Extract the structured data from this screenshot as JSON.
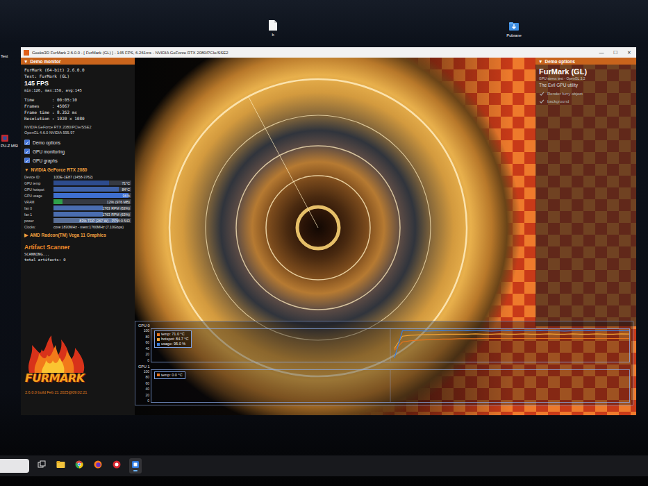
{
  "desktop": {
    "icons": [
      {
        "label": "b",
        "kind": "document"
      },
      {
        "label": "Pobrane",
        "kind": "downloads"
      }
    ],
    "edge_labels": [
      {
        "label": "Test",
        "kind": "plain"
      },
      {
        "label": "PU-Z MSI",
        "kind": "cpuz"
      }
    ]
  },
  "window": {
    "title": "Geeks3D FurMark 2.6.0.0 - [ FurMark (GL) ] - 145 FPS, 6.261ms - NVIDIA GeForce RTX 2080/PCIe/SSE2",
    "controls": [
      "—",
      "☐",
      "✕"
    ]
  },
  "monitor": {
    "toggle": "▼",
    "header": "Demo monitor",
    "app": "FurMark (64-bit) 2.6.0.0",
    "test": "Test: FurMark (GL)",
    "fps": "145 FPS",
    "fps_stats": "min:126, max:150, avg:145",
    "stats": [
      "Time       : 00:05:10",
      "Frames     : 45067",
      "Frame time : 8.352 ms",
      "Resolution : 1920 x 1080"
    ],
    "renderer": "NVIDIA GeForce RTX 2080/PCIe/SSE2",
    "opengl": "OpenGL 4.6.0 NVIDIA 595.97",
    "options": [
      {
        "label": "Demo options",
        "checked": true
      },
      {
        "label": "GPU monitoring",
        "checked": true
      },
      {
        "label": "GPU graphs",
        "checked": true
      }
    ]
  },
  "gpu": {
    "toggle": "▼",
    "name": "NVIDIA GeForce RTX 2080",
    "expanded": true,
    "device_label": "Device ID:",
    "device_id": "10DE-1E87 (1458-3762)",
    "rows": [
      {
        "label": "GPU temp",
        "value": "71°C",
        "level": 0.71,
        "color": "#2d4c8e"
      },
      {
        "label": "GPU hotspot",
        "value": "84°C",
        "level": 0.84,
        "color": "#3f62a8"
      },
      {
        "label": "GPU usage",
        "value": "96%",
        "level": 0.96,
        "color": "#3f6fcf"
      },
      {
        "label": "VRAM",
        "value": "12% (976 MB)",
        "level": 0.12,
        "color": "#2fa04a"
      },
      {
        "label": "fan 0",
        "value": "1763 RPM (63%)",
        "level": 0.63,
        "color": "#4a6db0"
      },
      {
        "label": "fan 1",
        "value": "1763 RPM (63%)",
        "level": 0.63,
        "color": "#4a6db0"
      },
      {
        "label": "power",
        "value": "83% TDP (267 W) - PPW:0.543",
        "level": 0.83,
        "color": "#5a6f96"
      }
    ],
    "clocks_label": "Clocks:",
    "clocks": "core:1830MHz - mem:1760MHz (7.10Gbps)"
  },
  "other_gpu": {
    "toggle": "▶",
    "name": "AMD Radeon(TM) Vega 11 Graphics",
    "expanded": false
  },
  "artifacts": {
    "title": "Artifact Scanner",
    "status": "SCANNING...",
    "total": "total artifacts: 0"
  },
  "logo": {
    "text": "FURMARK",
    "build": "2.6.0.0 build Feb 21 2025@09:02:21"
  },
  "options_panel": {
    "toggle": "▼",
    "header": "Demo options",
    "title": "FurMark (GL)",
    "subtitle": "GPU stress test - OpenGL 3.2",
    "tagline": "The Evil GPU utility",
    "items": [
      {
        "label": "Render furry object",
        "checked": true
      },
      {
        "label": "background",
        "checked": true
      }
    ]
  },
  "graphs": [
    {
      "label": "GPU 0",
      "ticks": [
        "100",
        "80",
        "60",
        "40",
        "20",
        "0"
      ],
      "series": [
        {
          "legend": "temp: 71.0 °C",
          "color": "#e8741c",
          "values": [
            35,
            60,
            64,
            66,
            67,
            68,
            69,
            69,
            70,
            70,
            70,
            71,
            71,
            71,
            71,
            71,
            71,
            71,
            71,
            71,
            71,
            71,
            71,
            71,
            71,
            71,
            71,
            71,
            71,
            71
          ]
        },
        {
          "legend": "hotspot: 84.7 °C",
          "color": "#f2a233",
          "values": [
            40,
            78,
            81,
            82,
            83,
            83,
            84,
            84,
            84,
            84,
            85,
            84,
            84,
            85,
            84,
            84,
            85,
            84,
            84,
            85,
            84,
            84,
            85,
            84,
            84,
            85,
            84,
            84,
            85,
            84.7
          ]
        },
        {
          "legend": "usage: 95.0 %",
          "color": "#3a7fe0",
          "values": [
            10,
            95,
            96,
            95,
            94,
            95,
            96,
            95,
            95,
            96,
            95,
            95,
            94,
            95,
            96,
            95,
            95,
            95,
            96,
            95,
            95,
            94,
            95,
            95,
            96,
            95,
            95,
            95,
            96,
            95
          ]
        }
      ]
    },
    {
      "label": "GPU 1",
      "ticks": [
        "100",
        "80",
        "60",
        "40",
        "20",
        "0"
      ],
      "series": [
        {
          "legend": "temp: 0.0 °C",
          "color": "#e8741c",
          "values": []
        }
      ]
    }
  ],
  "taskbar": {
    "apps": [
      {
        "kind": "taskview",
        "selected": false
      },
      {
        "kind": "explorer",
        "selected": false
      },
      {
        "kind": "chrome",
        "selected": false
      },
      {
        "kind": "firefox",
        "selected": false
      },
      {
        "kind": "app",
        "selected": false
      },
      {
        "kind": "furmark",
        "selected": true
      }
    ]
  }
}
